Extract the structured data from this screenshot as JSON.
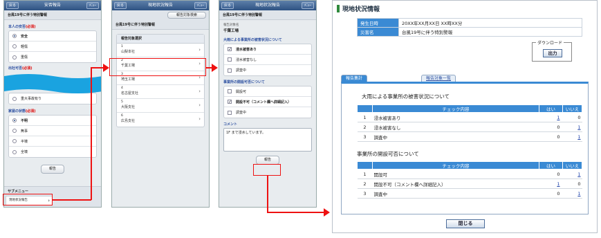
{
  "phone1": {
    "back": "戻る",
    "title": "安否報告",
    "menu": "ﾒﾆｭｰ",
    "subtitle": "台風19号に伴う特別警報",
    "q1_label": "本人の安否",
    "required": "(必須)",
    "q1_options": [
      "安全",
      "軽傷",
      "重傷"
    ],
    "q2_label": "出社可否",
    "q2_options_visible": [
      "重大事故有り"
    ],
    "q3_label": "家屋の状態",
    "q3_options": [
      "不明",
      "無事",
      "半壊",
      "全壊"
    ],
    "report_btn": "報告",
    "submenu_label": "サブメニュー",
    "submenu_item": "現地状況報告",
    "chevron": "›"
  },
  "phone2": {
    "back": "戻る",
    "title": "現地状況報告",
    "menu": "ﾒﾆｭｰ",
    "search_btn": "報告対象検索",
    "subtitle": "台風19号に伴う特別警報",
    "list_head": "報告対象選択",
    "items": [
      {
        "num": "1",
        "name": "山梨本社"
      },
      {
        "num": "2",
        "name": "千葉工場"
      },
      {
        "num": "3",
        "name": "埼玉工場"
      },
      {
        "num": "4",
        "name": "名古屋支社"
      },
      {
        "num": "5",
        "name": "大阪支社"
      },
      {
        "num": "6",
        "name": "広島支社"
      }
    ],
    "chevron": "›"
  },
  "phone3": {
    "back": "戻る",
    "title": "現地状況報告",
    "menu": "ﾒﾆｭｰ",
    "subtitle": "台風19号に伴う特別警報",
    "target_label": "報告対象名",
    "target_value": "千葉工場",
    "q1_label": "大雨による事業所の被害状況について",
    "q1_options": [
      {
        "label": "浸水被害あり",
        "checked": true
      },
      {
        "label": "浸水被害なし",
        "checked": false
      },
      {
        "label": "調査中",
        "checked": false
      }
    ],
    "q2_label": "事業所の開設可否について",
    "q2_options": [
      {
        "label": "開設可",
        "checked": false
      },
      {
        "label": "開設不可（コメント欄へ詳細記入）",
        "checked": true
      },
      {
        "label": "調査中",
        "checked": false
      }
    ],
    "comment_label": "コメント",
    "comment_value": "1F まで浸水しています。",
    "report_btn": "報告",
    "check_mark": "✓"
  },
  "pc": {
    "title": "現地状況情報",
    "info": [
      {
        "key": "発生日時",
        "value": "20XX年XX月XX日 XX時XX分"
      },
      {
        "key": "災害名",
        "value": "台風19号に伴う特別警報"
      }
    ],
    "download_label": "ダウンロード",
    "download_btn": "出力",
    "tabs": [
      "報告集計",
      "報告対象一覧"
    ],
    "col_check": "チェック内容",
    "col_yes": "はい",
    "col_no": "いいえ",
    "section1": {
      "title": "大雨による事業所の被害状況について",
      "rows": [
        {
          "n": "1",
          "label": "浸水被害あり",
          "yes": "1",
          "no": "0"
        },
        {
          "n": "2",
          "label": "浸水被害なし",
          "yes": "0",
          "no": "1"
        },
        {
          "n": "3",
          "label": "調査中",
          "yes": "0",
          "no": "1"
        }
      ]
    },
    "section2": {
      "title": "事業所の開設可否について",
      "rows": [
        {
          "n": "1",
          "label": "開設可",
          "yes": "0",
          "no": "1"
        },
        {
          "n": "2",
          "label": "開設不可（コメント欄へ詳細記入）",
          "yes": "1",
          "no": "0"
        },
        {
          "n": "3",
          "label": "調査中",
          "yes": "0",
          "no": "1"
        }
      ]
    },
    "close_btn": "閉じる"
  },
  "colors": {
    "accent": "#3a8ad4",
    "arrow": "#e11111",
    "header": "#2e5283"
  }
}
